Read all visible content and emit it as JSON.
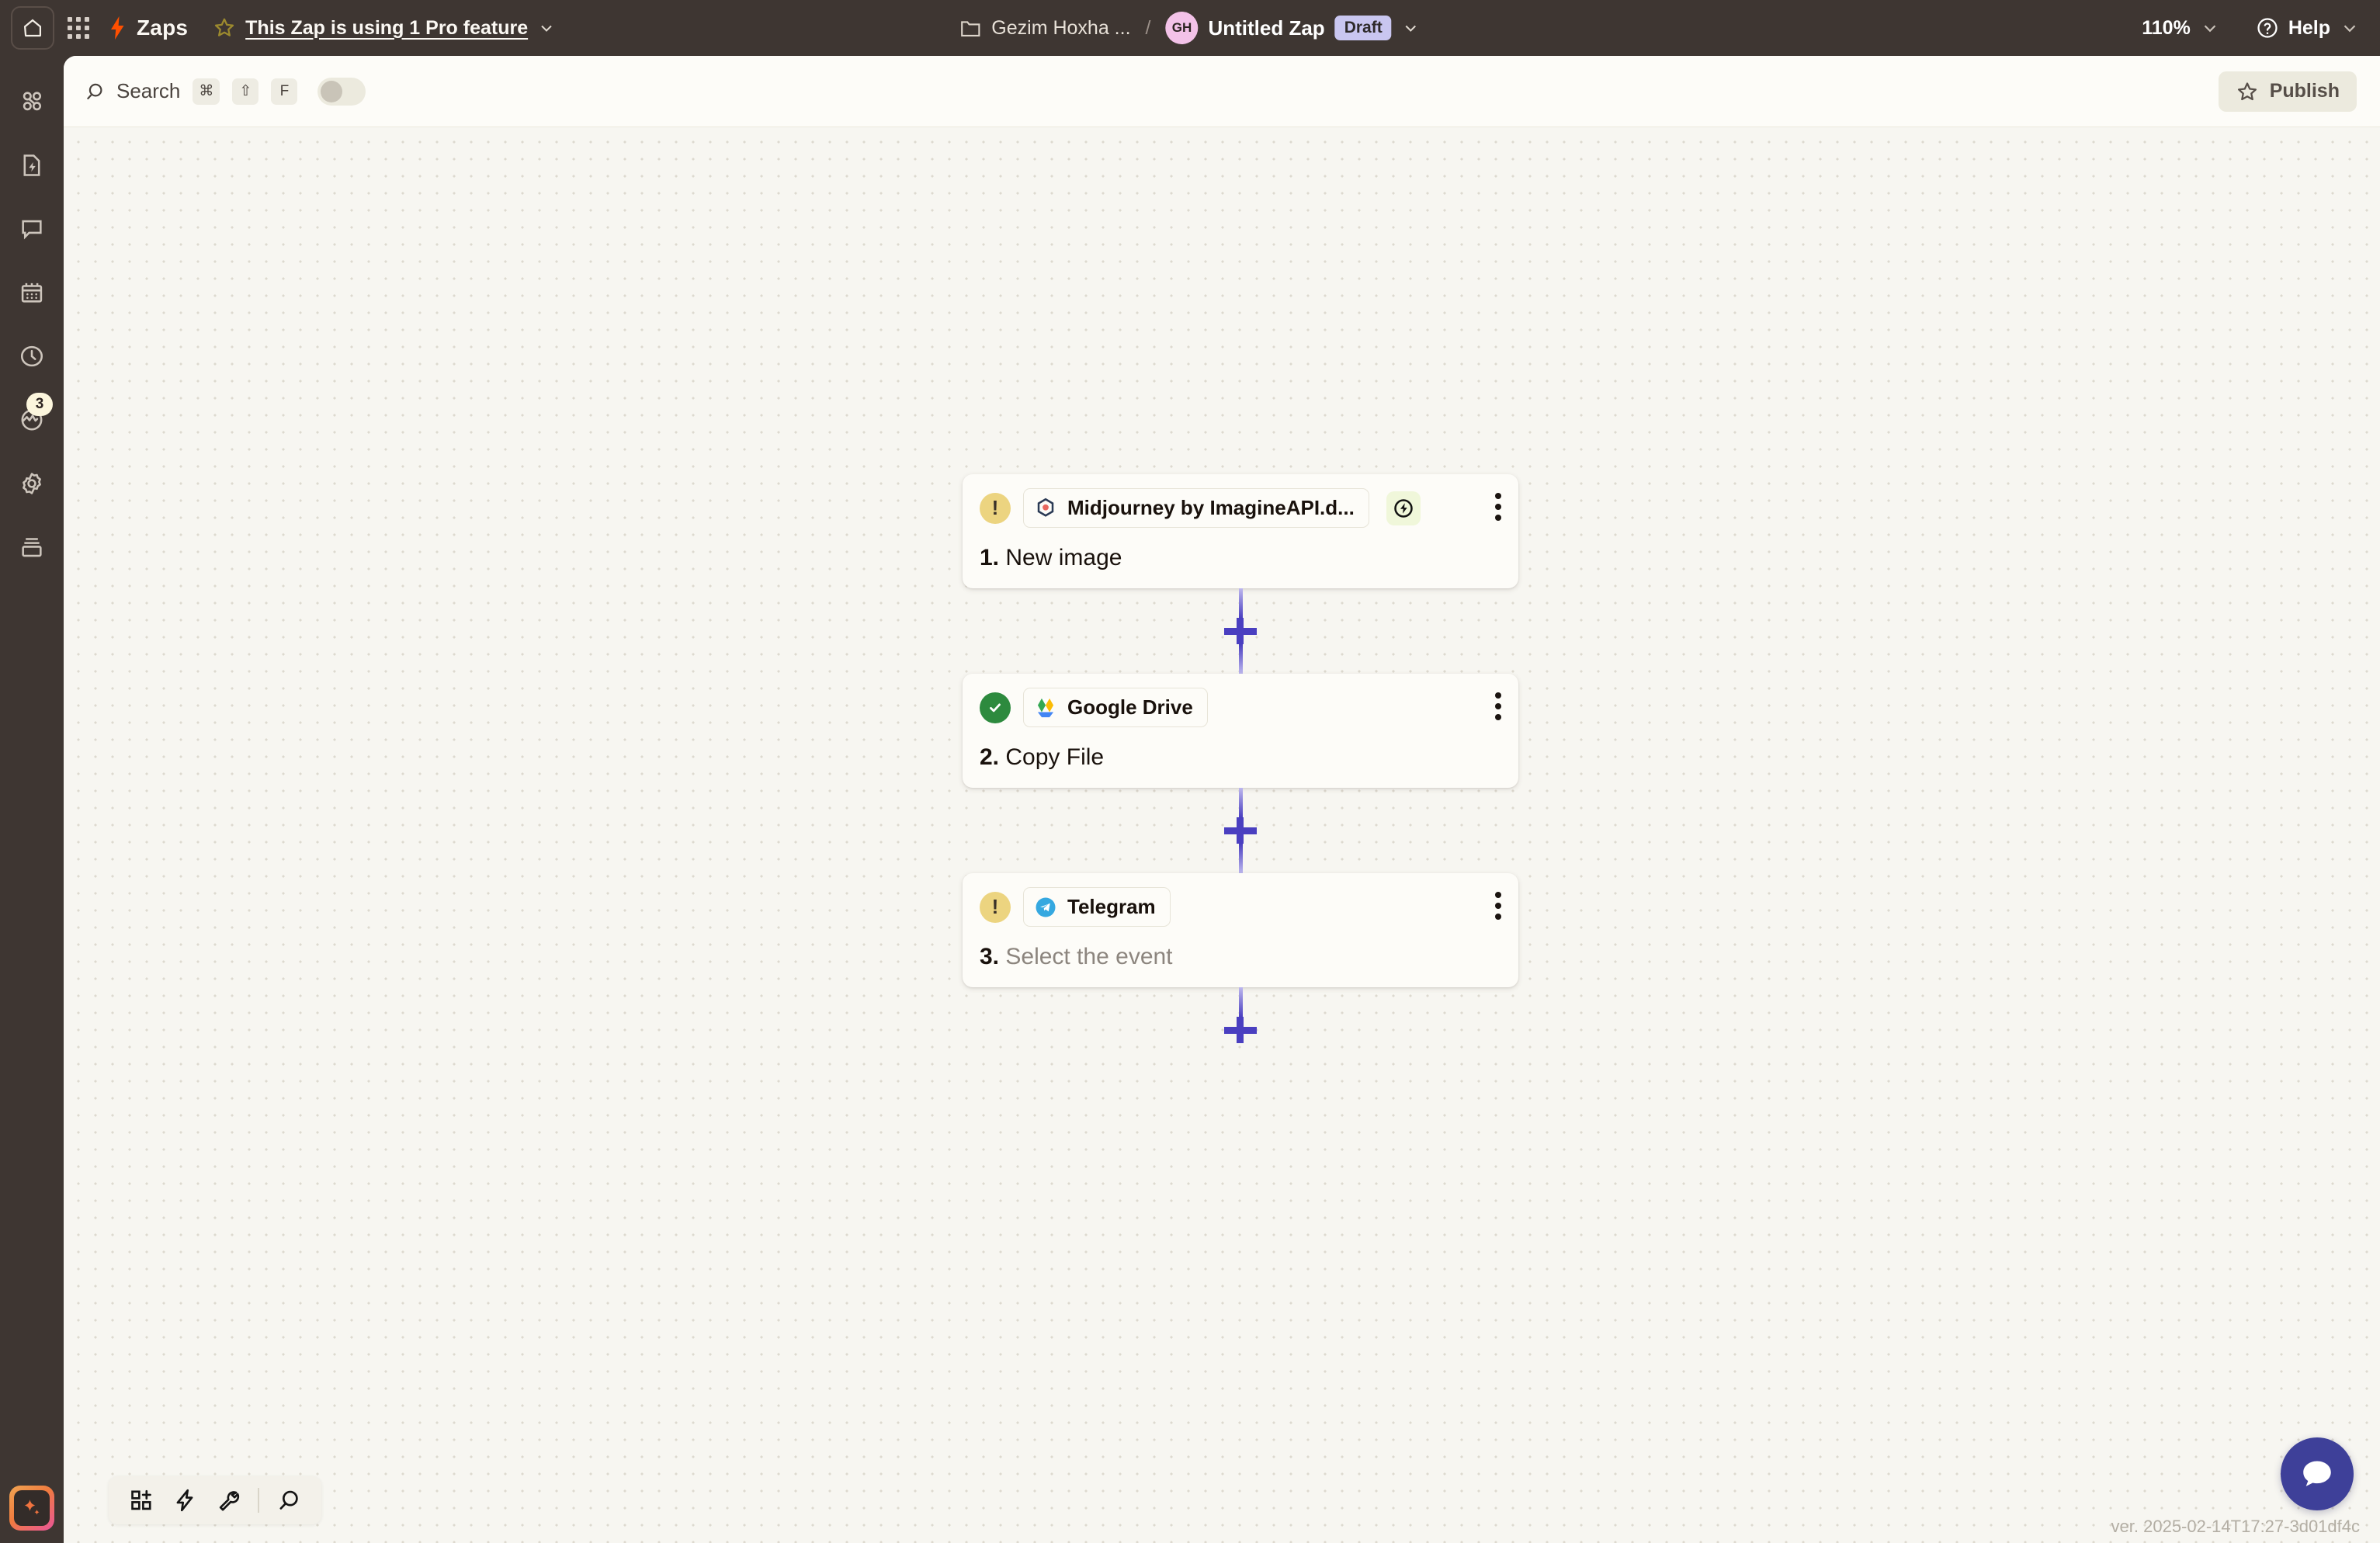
{
  "topbar": {
    "home_icon": "home-icon",
    "apps_icon": "app-grid-icon",
    "zaps_label": "Zaps",
    "star_icon": "star-icon",
    "pro_feature_text": "This Zap is using 1 Pro feature",
    "pro_chevron_icon": "chevron-down-icon",
    "folder_icon": "folder-icon",
    "folder_name": "Gezim Hoxha ...",
    "separator": "/",
    "avatar_initials": "GH",
    "zap_title": "Untitled Zap",
    "status_badge": "Draft",
    "title_chevron_icon": "chevron-down-icon",
    "zoom_level": "110%",
    "zoom_chevron_icon": "chevron-down-icon",
    "help_icon": "question-circle-icon",
    "help_label": "Help",
    "help_chevron_icon": "chevron-down-icon"
  },
  "sidebar": {
    "items": [
      {
        "name": "sidebar-item-apps",
        "icon": "apps-grid-icon",
        "badge": null
      },
      {
        "name": "sidebar-item-zap-history",
        "icon": "zap-document-icon",
        "badge": null
      },
      {
        "name": "sidebar-item-chat",
        "icon": "chat-bubble-icon",
        "badge": null
      },
      {
        "name": "sidebar-item-calendar",
        "icon": "calendar-icon",
        "badge": null
      },
      {
        "name": "sidebar-item-history",
        "icon": "clock-icon",
        "badge": null
      },
      {
        "name": "sidebar-item-activity",
        "icon": "globe-activity-icon",
        "badge": "3"
      },
      {
        "name": "sidebar-item-settings",
        "icon": "gear-icon",
        "badge": null
      },
      {
        "name": "sidebar-item-tables",
        "icon": "database-icon",
        "badge": null
      }
    ],
    "ai_button": {
      "name": "ai-sparkle-button",
      "icon": "sparkle-icon"
    }
  },
  "search": {
    "icon": "search-icon",
    "label": "Search",
    "shortcuts": [
      "⌘",
      "⇧",
      "F"
    ],
    "toggle_state": "off"
  },
  "publish": {
    "icon": "star-icon",
    "label": "Publish"
  },
  "flow": {
    "nodes": [
      {
        "status": "warning",
        "status_icon": "warning-exclamation-icon",
        "app_icon": "midjourney-icon",
        "app_name": "Midjourney by ImagineAPI.d...",
        "trigger_badge_icon": "lightning-circle-icon",
        "has_trigger_badge": true,
        "step_number": "1.",
        "step_title": "New image",
        "placeholder": false,
        "menu_icon": "kebab-menu-icon"
      },
      {
        "status": "ok",
        "status_icon": "check-circle-icon",
        "app_icon": "google-drive-icon",
        "app_name": "Google Drive",
        "trigger_badge_icon": null,
        "has_trigger_badge": false,
        "step_number": "2.",
        "step_title": "Copy File",
        "placeholder": false,
        "menu_icon": "kebab-menu-icon"
      },
      {
        "status": "warning",
        "status_icon": "warning-exclamation-icon",
        "app_icon": "telegram-icon",
        "app_name": "Telegram",
        "trigger_badge_icon": null,
        "has_trigger_badge": false,
        "step_number": "3.",
        "step_title": "Select the event",
        "placeholder": true,
        "menu_icon": "kebab-menu-icon"
      }
    ],
    "add_step_icon": "plus-icon"
  },
  "bottom_toolbar": {
    "items": [
      {
        "name": "add-block-button",
        "icon": "add-block-icon"
      },
      {
        "name": "zap-tool-button",
        "icon": "lightning-icon"
      },
      {
        "name": "tools-button",
        "icon": "wrench-icon"
      },
      {
        "name": "zoom-search-button",
        "icon": "search-icon"
      }
    ]
  },
  "chat_fab": {
    "icon": "chat-bubble-icon"
  },
  "version": "ver. 2025-02-14T17:27-3d01df4c",
  "colors": {
    "topbar_bg": "#3e3632",
    "panel_bg": "#fdfcf8",
    "canvas_bg": "#f7f6f1",
    "connector": "#4a3fc0",
    "warning": "#ecd480",
    "success": "#2d8a3e",
    "draft_badge": "#c9c6f0",
    "trigger_badge": "#f0f7da",
    "chat_fab": "#3e4099"
  }
}
